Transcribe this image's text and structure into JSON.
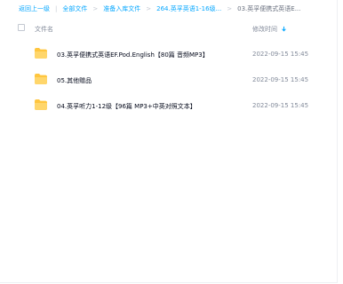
{
  "breadcrumb": {
    "back": "返回上一级",
    "items": [
      "全部文件",
      "准备入库文件",
      "264.英孚英语1-16级..."
    ],
    "current": "03.英孚便携式英语E..."
  },
  "table": {
    "header_name": "文件名",
    "header_time": "修改时间",
    "rows": [
      {
        "name": "03.英孚便携式英语EF.Pod.English【80篇 音频MP3】",
        "time": "2022-09-15 15:45"
      },
      {
        "name": "05.其他赠品",
        "time": "2022-09-15 15:45"
      },
      {
        "name": "04.英孚听力1-12级【96篇 MP3+中英对照文本】",
        "time": "2022-09-15 15:45"
      }
    ]
  },
  "icons": {
    "folder": "folder-icon",
    "sort": "sort-desc-icon"
  },
  "colors": {
    "link": "#06a7ff",
    "folder": "#ffc63f",
    "text": "#03081a",
    "muted": "#818999"
  }
}
